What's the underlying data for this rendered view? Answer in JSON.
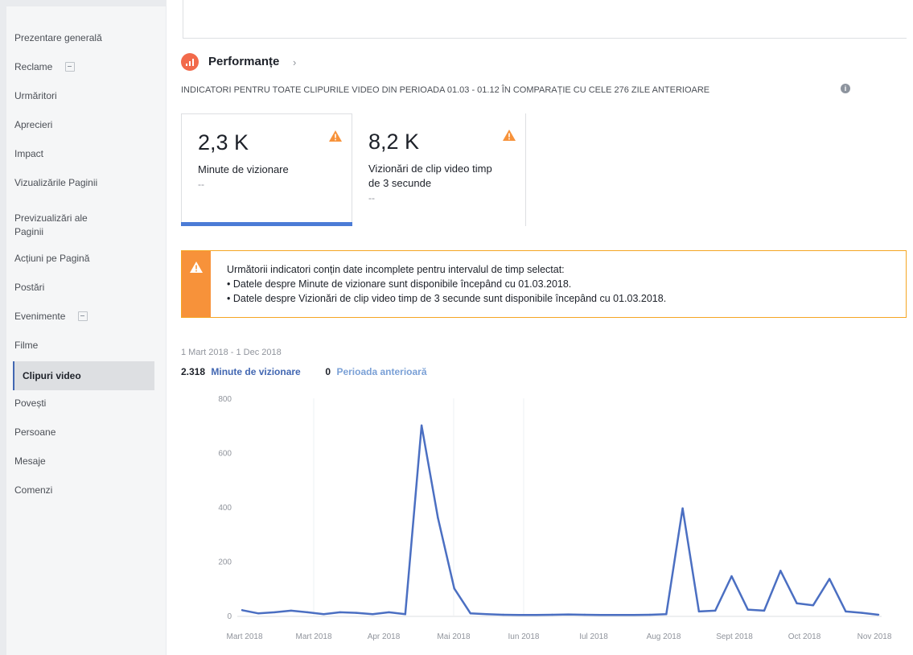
{
  "sidebar": {
    "items": [
      {
        "label": "Prezentare generală"
      },
      {
        "label": "Reclame",
        "expand": true
      },
      {
        "label": "Urmăritori"
      },
      {
        "label": "Aprecieri"
      },
      {
        "label": "Impact"
      },
      {
        "label": "Vizualizările Paginii"
      },
      {
        "label": "Previzualizări ale Paginii"
      },
      {
        "label": "Acțiuni pe Pagină"
      },
      {
        "label": "Postări"
      },
      {
        "label": "Evenimente",
        "expand": true
      },
      {
        "label": "Filme"
      },
      {
        "label": "Clipuri video",
        "active": true
      },
      {
        "label": "Povești"
      },
      {
        "label": "Persoane"
      },
      {
        "label": "Mesaje"
      },
      {
        "label": "Comenzi"
      }
    ]
  },
  "performance": {
    "title": "Performanțe",
    "chevron": "›",
    "subtitle": "INDICATORI PENTRU TOATE CLIPURILE VIDEO DIN PERIOADA 01.03 - 01.12 ÎN COMPARAȚIE CU CELE 276 ZILE ANTERIOARE",
    "info": "i"
  },
  "cards": [
    {
      "value": "2,3 K",
      "label": "Minute de vizionare",
      "delta": "--"
    },
    {
      "value": "8,2 K",
      "label": "Vizionări de clip video timp de 3 secunde",
      "delta": "--"
    }
  ],
  "notice": {
    "heading": "Următorii indicatori conțin date incomplete pentru intervalul de timp selectat:",
    "line1": "• Datele despre Minute de vizionare sunt disponibile începând cu 01.03.2018.",
    "line2": "• Datele despre Vizionări de clip video timp de 3 secunde sunt disponibile începând cu 01.03.2018."
  },
  "colors": {
    "accent": "#4267b2",
    "line": "#4b6fc2",
    "warning": "#f7923a",
    "previous_period": "#7aa0d6"
  },
  "chart_data": {
    "type": "line",
    "date_range": "1 Mart 2018 - 1 Dec 2018",
    "series": [
      {
        "name": "Minute de vizionare",
        "total": "2.318"
      },
      {
        "name": "Perioada anterioară",
        "total": "0"
      }
    ],
    "ylim": [
      0,
      800
    ],
    "yticks": [
      0,
      200,
      400,
      600,
      800
    ],
    "xticks": [
      "Mart 2018",
      "Mart 2018",
      "Apr 2018",
      "Mai 2018",
      "Iun 2018",
      "Iul 2018",
      "Aug 2018",
      "Sept 2018",
      "Oct 2018",
      "Nov 2018"
    ],
    "points": [
      [
        "2018-03-01",
        20
      ],
      [
        "2018-03-08",
        8
      ],
      [
        "2018-03-15",
        12
      ],
      [
        "2018-03-22",
        18
      ],
      [
        "2018-03-29",
        12
      ],
      [
        "2018-04-05",
        5
      ],
      [
        "2018-04-12",
        12
      ],
      [
        "2018-04-19",
        10
      ],
      [
        "2018-04-26",
        5
      ],
      [
        "2018-05-03",
        12
      ],
      [
        "2018-05-10",
        5
      ],
      [
        "2018-05-17",
        700
      ],
      [
        "2018-05-24",
        360
      ],
      [
        "2018-05-31",
        100
      ],
      [
        "2018-06-07",
        8
      ],
      [
        "2018-06-14",
        5
      ],
      [
        "2018-06-21",
        3
      ],
      [
        "2018-06-28",
        2
      ],
      [
        "2018-07-05",
        2
      ],
      [
        "2018-07-12",
        3
      ],
      [
        "2018-07-19",
        4
      ],
      [
        "2018-07-26",
        3
      ],
      [
        "2018-08-02",
        2
      ],
      [
        "2018-08-09",
        2
      ],
      [
        "2018-08-16",
        2
      ],
      [
        "2018-08-23",
        3
      ],
      [
        "2018-08-30",
        5
      ],
      [
        "2018-09-06",
        395
      ],
      [
        "2018-09-13",
        15
      ],
      [
        "2018-09-20",
        18
      ],
      [
        "2018-09-27",
        145
      ],
      [
        "2018-10-04",
        22
      ],
      [
        "2018-10-11",
        18
      ],
      [
        "2018-10-18",
        165
      ],
      [
        "2018-10-25",
        45
      ],
      [
        "2018-11-01",
        38
      ],
      [
        "2018-11-08",
        135
      ],
      [
        "2018-11-15",
        15
      ],
      [
        "2018-11-22",
        10
      ],
      [
        "2018-11-29",
        3
      ]
    ]
  }
}
